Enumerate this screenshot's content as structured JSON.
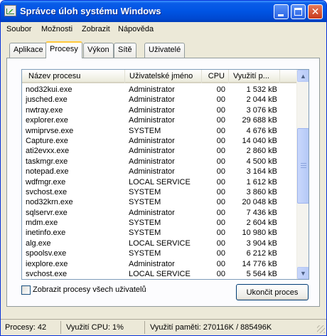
{
  "window": {
    "title": "Správce úloh systému Windows",
    "app_icon": "task-manager-icon",
    "controls": [
      "minimize-icon",
      "maximize-icon",
      "close-icon"
    ],
    "accent": "#0054e3"
  },
  "menu": {
    "items": [
      "Soubor",
      "Možnosti",
      "Zobrazit",
      "Nápověda"
    ]
  },
  "tabs": {
    "items": [
      "Aplikace",
      "Procesy",
      "Výkon",
      "Sítě",
      "Uživatelé"
    ],
    "active": "Procesy"
  },
  "process_list": {
    "columns": [
      "Název procesu",
      "Uživatelské jméno",
      "CPU",
      "Využití p..."
    ],
    "rows": [
      [
        "nod32kui.exe",
        "Administrator",
        "00",
        "1 532 kB"
      ],
      [
        "jusched.exe",
        "Administrator",
        "00",
        "2 044 kB"
      ],
      [
        "nwtray.exe",
        "Administrator",
        "00",
        "3 076 kB"
      ],
      [
        "explorer.exe",
        "Administrator",
        "00",
        "29 688 kB"
      ],
      [
        "wmiprvse.exe",
        "SYSTEM",
        "00",
        "4 676 kB"
      ],
      [
        "Capture.exe",
        "Administrator",
        "00",
        "14 040 kB"
      ],
      [
        "ati2evxx.exe",
        "Administrator",
        "00",
        "2 860 kB"
      ],
      [
        "taskmgr.exe",
        "Administrator",
        "00",
        "4 500 kB"
      ],
      [
        "notepad.exe",
        "Administrator",
        "00",
        "3 164 kB"
      ],
      [
        "wdfmgr.exe",
        "LOCAL SERVICE",
        "00",
        "1 612 kB"
      ],
      [
        "svchost.exe",
        "SYSTEM",
        "00",
        "3 860 kB"
      ],
      [
        "nod32krn.exe",
        "SYSTEM",
        "00",
        "20 048 kB"
      ],
      [
        "sqlservr.exe",
        "Administrator",
        "00",
        "7 436 kB"
      ],
      [
        "mdm.exe",
        "SYSTEM",
        "00",
        "2 604 kB"
      ],
      [
        "inetinfo.exe",
        "SYSTEM",
        "00",
        "10 980 kB"
      ],
      [
        "alg.exe",
        "LOCAL SERVICE",
        "00",
        "3 904 kB"
      ],
      [
        "spoolsv.exe",
        "SYSTEM",
        "00",
        "6 212 kB"
      ],
      [
        "iexplore.exe",
        "Administrator",
        "00",
        "14 776 kB"
      ],
      [
        "svchost.exe",
        "LOCAL SERVICE",
        "00",
        "5 564 kB"
      ]
    ]
  },
  "show_all_users": {
    "label": "Zobrazit procesy všech uživatelů",
    "checked": false
  },
  "end_process_button": "Ukončit proces",
  "status": {
    "processes": "Procesy: 42",
    "cpu": "Využití CPU: 1%",
    "memory": "Využití paměti: 270116K / 885496K"
  }
}
